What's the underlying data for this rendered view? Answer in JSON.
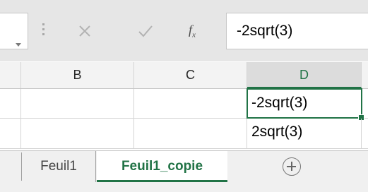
{
  "formula_bar": {
    "fx_label": "f",
    "fx_sub": "x",
    "value": "-2sqrt(3)"
  },
  "columns": [
    "B",
    "C",
    "D"
  ],
  "active_column": "D",
  "rows": [
    {
      "B": "",
      "C": "",
      "D": "-2sqrt(3)"
    },
    {
      "B": "",
      "C": "",
      "D": "2sqrt(3)"
    }
  ],
  "sheet_tabs": [
    {
      "label": "Feuil1",
      "active": false
    },
    {
      "label": "Feuil1_copie",
      "active": true
    }
  ],
  "colors": {
    "accent": "#217346",
    "selection_border": "#217346"
  },
  "icons": [
    "dropdown-arrow-icon",
    "cancel-x-icon",
    "enter-check-icon",
    "function-fx-icon",
    "add-sheet-plus-icon"
  ]
}
